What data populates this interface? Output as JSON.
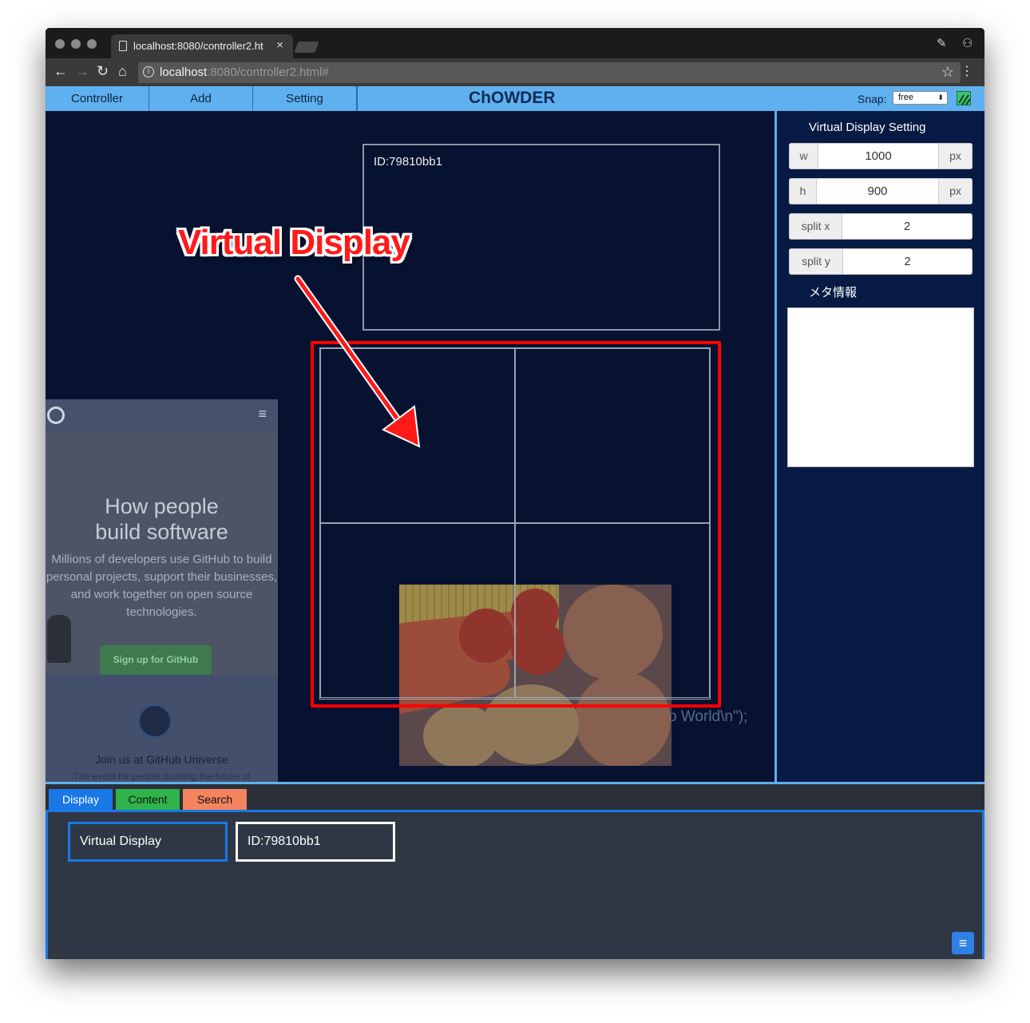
{
  "browser": {
    "tab_title": "localhost:8080/controller2.ht",
    "tab_close": "×",
    "url_host": "localhost",
    "url_rest": ":8080/controller2.html#"
  },
  "appbar": {
    "menu": [
      "Controller",
      "Add",
      "Setting"
    ],
    "title": "ChOWDER",
    "snap_label": "Snap:",
    "snap_value": "free"
  },
  "canvas": {
    "display_id": "ID:79810bb1",
    "annotation": "Virtual Display",
    "code_snippet": "o World\\n\");",
    "github": {
      "headline_1": "How people",
      "headline_2": "build software",
      "paragraph": "Millions of developers use GitHub to build personal projects, support their businesses, and work together on open source technologies.",
      "signup": "Sign up for GitHub",
      "join": "Join us at GitHub Universe",
      "event": "The event for people building the future of"
    }
  },
  "sidepanel": {
    "title": "Virtual Display Setting",
    "w_label": "w",
    "w_value": "1000",
    "w_unit": "px",
    "h_label": "h",
    "h_value": "900",
    "h_unit": "px",
    "split_x_label": "split x",
    "split_x_value": "2",
    "split_y_label": "split y",
    "split_y_value": "2",
    "meta_label": "メタ情報"
  },
  "bottom": {
    "tabs": [
      "Display",
      "Content",
      "Search"
    ],
    "tab_colors": [
      "#1a78e6",
      "#2fb34a",
      "#f4845f"
    ],
    "items": [
      "Virtual Display",
      "ID:79810bb1"
    ]
  }
}
